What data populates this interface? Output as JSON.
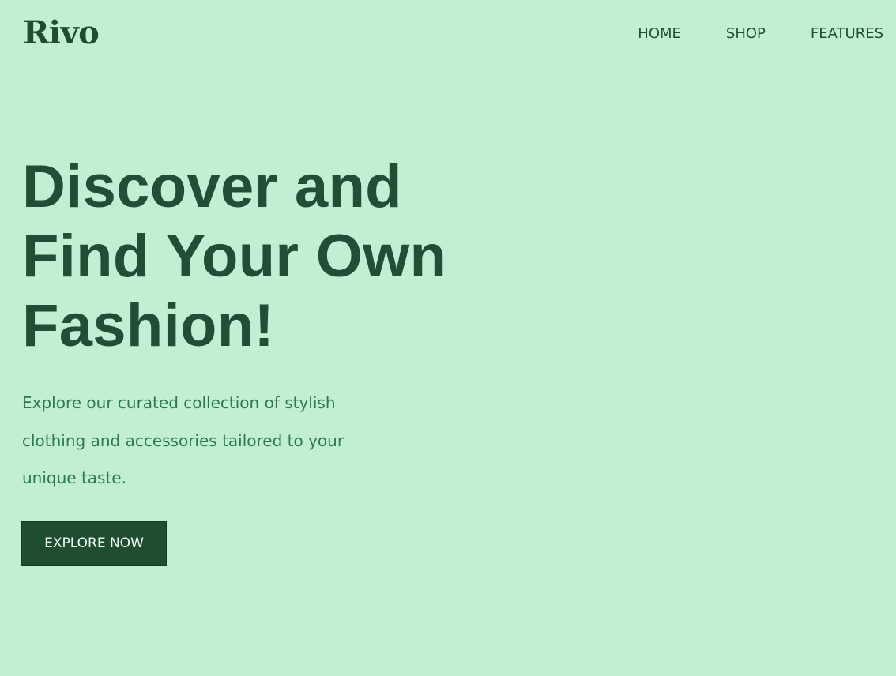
{
  "brand": {
    "logo_text": "Rivo"
  },
  "nav": {
    "items": [
      {
        "label": "HOME"
      },
      {
        "label": "SHOP"
      },
      {
        "label": "FEATURES"
      }
    ]
  },
  "hero": {
    "title_line_1": "Discover and",
    "title_line_2": "Find Your Own",
    "title_line_3": "Fashion!",
    "description": "Explore our curated collection of stylish clothing and accessories tailored to your unique taste.",
    "cta_label": "EXPLORE NOW"
  },
  "colors": {
    "background": "#c2eed3",
    "primary_dark": "#1f4d30",
    "heading": "#234d35",
    "body_text": "#2b7a4d",
    "button_text": "#f2fbf5"
  }
}
